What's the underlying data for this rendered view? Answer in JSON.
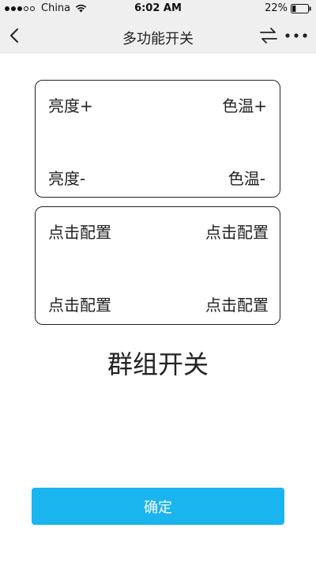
{
  "status_bar": {
    "carrier": "China",
    "time": "6:02 AM",
    "battery": "22%",
    "signal_filled": 3,
    "signal_total": 5,
    "battery_level": 0.22
  },
  "nav": {
    "title": "多功能开关",
    "back_icon": "chevron-left-icon",
    "swap_icon": "swap-arrows-icon",
    "more_icon": "more-dots-icon"
  },
  "panels": {
    "top": {
      "top_left": "亮度+",
      "top_right": "色温+",
      "bottom_left": "亮度-",
      "bottom_right": "色温-"
    },
    "bottom": {
      "top_left": "点击配置",
      "top_right": "点击配置",
      "bottom_left": "点击配置",
      "bottom_right": "点击配置"
    }
  },
  "group_title": "群组开关",
  "confirm_label": "确定",
  "colors": {
    "accent": "#1ab4ee",
    "bar_bg": "#efefef",
    "text": "#222222"
  }
}
